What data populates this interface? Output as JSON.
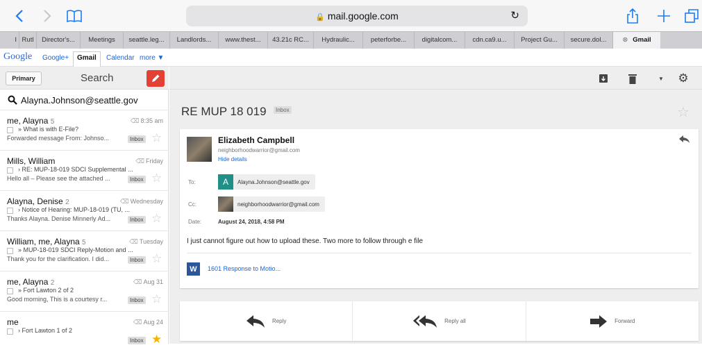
{
  "browser": {
    "url": "mail.google.com",
    "tabs": [
      "I",
      "Rutl",
      "Director's...",
      "Meetings",
      "seattle.leg...",
      "Landlords...",
      "www.thest...",
      "43.21c RC...",
      "Hydraulic...",
      "peterforbe...",
      "digitalcom...",
      "cdn.ca9.u...",
      "Project Gu...",
      "secure.dol...",
      "Gmail"
    ],
    "active_tab": "Gmail"
  },
  "gbar": {
    "logo": "Google",
    "links": [
      "Google+",
      "Gmail",
      "Calendar",
      "more ▼"
    ]
  },
  "sidebar": {
    "primary_label": "Primary",
    "search_label": "Search",
    "search_query": "Alayna.Johnson@seattle.gov",
    "threads": [
      {
        "sender": "me, Alayna",
        "count": "5",
        "time": "8:35 am",
        "subject": "» What is with E-File?",
        "snippet": "Forwarded message From: Johnso...",
        "label": "Inbox",
        "starred": false
      },
      {
        "sender": "Mills, William",
        "count": "",
        "time": "Friday",
        "subject": "› RE: MUP-18-019 SDCI Supplemental ...",
        "snippet": "Hello all – Please see the attached ...",
        "label": "Inbox",
        "starred": false
      },
      {
        "sender": "Alayna, Denise",
        "count": "2",
        "time": "Wednesday",
        "subject": "› Notice of Hearing: MUP-18-019 (TU, ...",
        "snippet": "Thanks Alayna. Denise Minnerly Ad...",
        "label": "Inbox",
        "starred": false
      },
      {
        "sender": "William, me, Alayna",
        "count": "5",
        "time": "Tuesday",
        "subject": "» MUP-18-019 SDCI Reply-Motion and ...",
        "snippet": "Thank you for the clarification. I did...",
        "label": "Inbox",
        "starred": false
      },
      {
        "sender": "me, Alayna",
        "count": "2",
        "time": "Aug 31",
        "subject": "» Fort Lawton 2 of 2",
        "snippet": "Good morning, This is a courtesy r...",
        "label": "Inbox",
        "starred": false
      },
      {
        "sender": "me",
        "count": "",
        "time": "Aug 24",
        "subject": "› Fort Lawton 1 of 2",
        "snippet": "",
        "label": "Inbox",
        "starred": true
      }
    ]
  },
  "message": {
    "subject": "RE MUP 18 019",
    "label": "Inbox",
    "from_name": "Elizabeth Campbell",
    "from_email": "neighborhoodwarrior@gmail.com",
    "hide_details": "Hide details",
    "to_label": "To:",
    "to_initial": "A",
    "to_value": "Alayna.Johnson@seattle.gov",
    "cc_label": "Cc:",
    "cc_value": "neighborhoodwarrior@gmail.com",
    "date_label": "Date:",
    "date_value": "August 24, 2018, 4:58 PM",
    "body": "I just cannot figure out how to upload these.  Two more to follow through e file",
    "attachment_icon": "W",
    "attachment_name": "1601 Response to Motio..."
  },
  "actions": {
    "reply": "Reply",
    "reply_all": "Reply all",
    "forward": "Forward"
  },
  "colors": {
    "accent": "#1a7cf5",
    "compose": "#e34133",
    "word": "#2b579a",
    "star": "#f4b400",
    "to_avatar": "#1f8f88"
  },
  "icons": [
    "back-icon",
    "forward-nav-icon",
    "bookmarks-icon",
    "lock-icon",
    "reload-icon",
    "share-icon",
    "new-tab-icon",
    "tabs-icon",
    "compose-icon",
    "search-icon",
    "archive-icon",
    "trash-icon",
    "dropdown-icon",
    "settings-icon",
    "star-icon",
    "reply-icon",
    "reply-all-icon",
    "forward-icon",
    "word-icon"
  ]
}
